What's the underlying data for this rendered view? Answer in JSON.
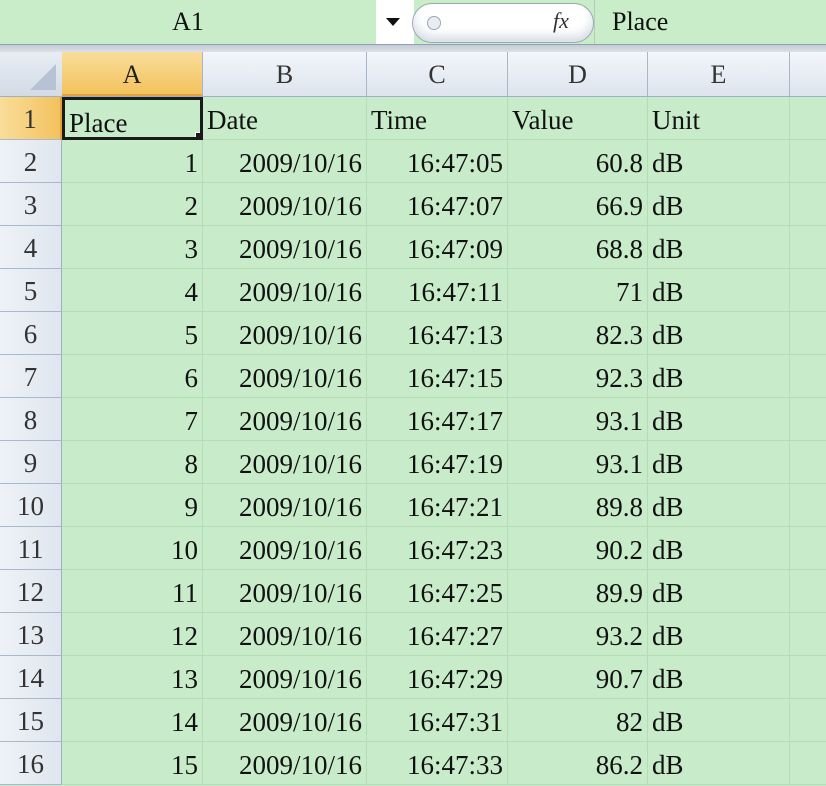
{
  "formula_bar": {
    "name_box": "A1",
    "fx_label": "fx",
    "value": "Place"
  },
  "columns": [
    "A",
    "B",
    "C",
    "D",
    "E"
  ],
  "rows": [
    {
      "num": "1",
      "cells": [
        "Place",
        "Date",
        "Time",
        "Value",
        "Unit"
      ]
    },
    {
      "num": "2",
      "cells": [
        "1",
        "2009/10/16",
        "16:47:05",
        "60.8",
        "dB"
      ]
    },
    {
      "num": "3",
      "cells": [
        "2",
        "2009/10/16",
        "16:47:07",
        "66.9",
        "dB"
      ]
    },
    {
      "num": "4",
      "cells": [
        "3",
        "2009/10/16",
        "16:47:09",
        "68.8",
        "dB"
      ]
    },
    {
      "num": "5",
      "cells": [
        "4",
        "2009/10/16",
        "16:47:11",
        "71",
        "dB"
      ]
    },
    {
      "num": "6",
      "cells": [
        "5",
        "2009/10/16",
        "16:47:13",
        "82.3",
        "dB"
      ]
    },
    {
      "num": "7",
      "cells": [
        "6",
        "2009/10/16",
        "16:47:15",
        "92.3",
        "dB"
      ]
    },
    {
      "num": "8",
      "cells": [
        "7",
        "2009/10/16",
        "16:47:17",
        "93.1",
        "dB"
      ]
    },
    {
      "num": "9",
      "cells": [
        "8",
        "2009/10/16",
        "16:47:19",
        "93.1",
        "dB"
      ]
    },
    {
      "num": "10",
      "cells": [
        "9",
        "2009/10/16",
        "16:47:21",
        "89.8",
        "dB"
      ]
    },
    {
      "num": "11",
      "cells": [
        "10",
        "2009/10/16",
        "16:47:23",
        "90.2",
        "dB"
      ]
    },
    {
      "num": "12",
      "cells": [
        "11",
        "2009/10/16",
        "16:47:25",
        "89.9",
        "dB"
      ]
    },
    {
      "num": "13",
      "cells": [
        "12",
        "2009/10/16",
        "16:47:27",
        "93.2",
        "dB"
      ]
    },
    {
      "num": "14",
      "cells": [
        "13",
        "2009/10/16",
        "16:47:29",
        "90.7",
        "dB"
      ]
    },
    {
      "num": "15",
      "cells": [
        "14",
        "2009/10/16",
        "16:47:31",
        "82",
        "dB"
      ]
    },
    {
      "num": "16",
      "cells": [
        "15",
        "2009/10/16",
        "16:47:33",
        "86.2",
        "dB"
      ]
    }
  ],
  "selection": {
    "active_cell": "A1"
  },
  "colors": {
    "sheet_bg": "#c8ecc9",
    "selection_header": "#f3c25e"
  }
}
